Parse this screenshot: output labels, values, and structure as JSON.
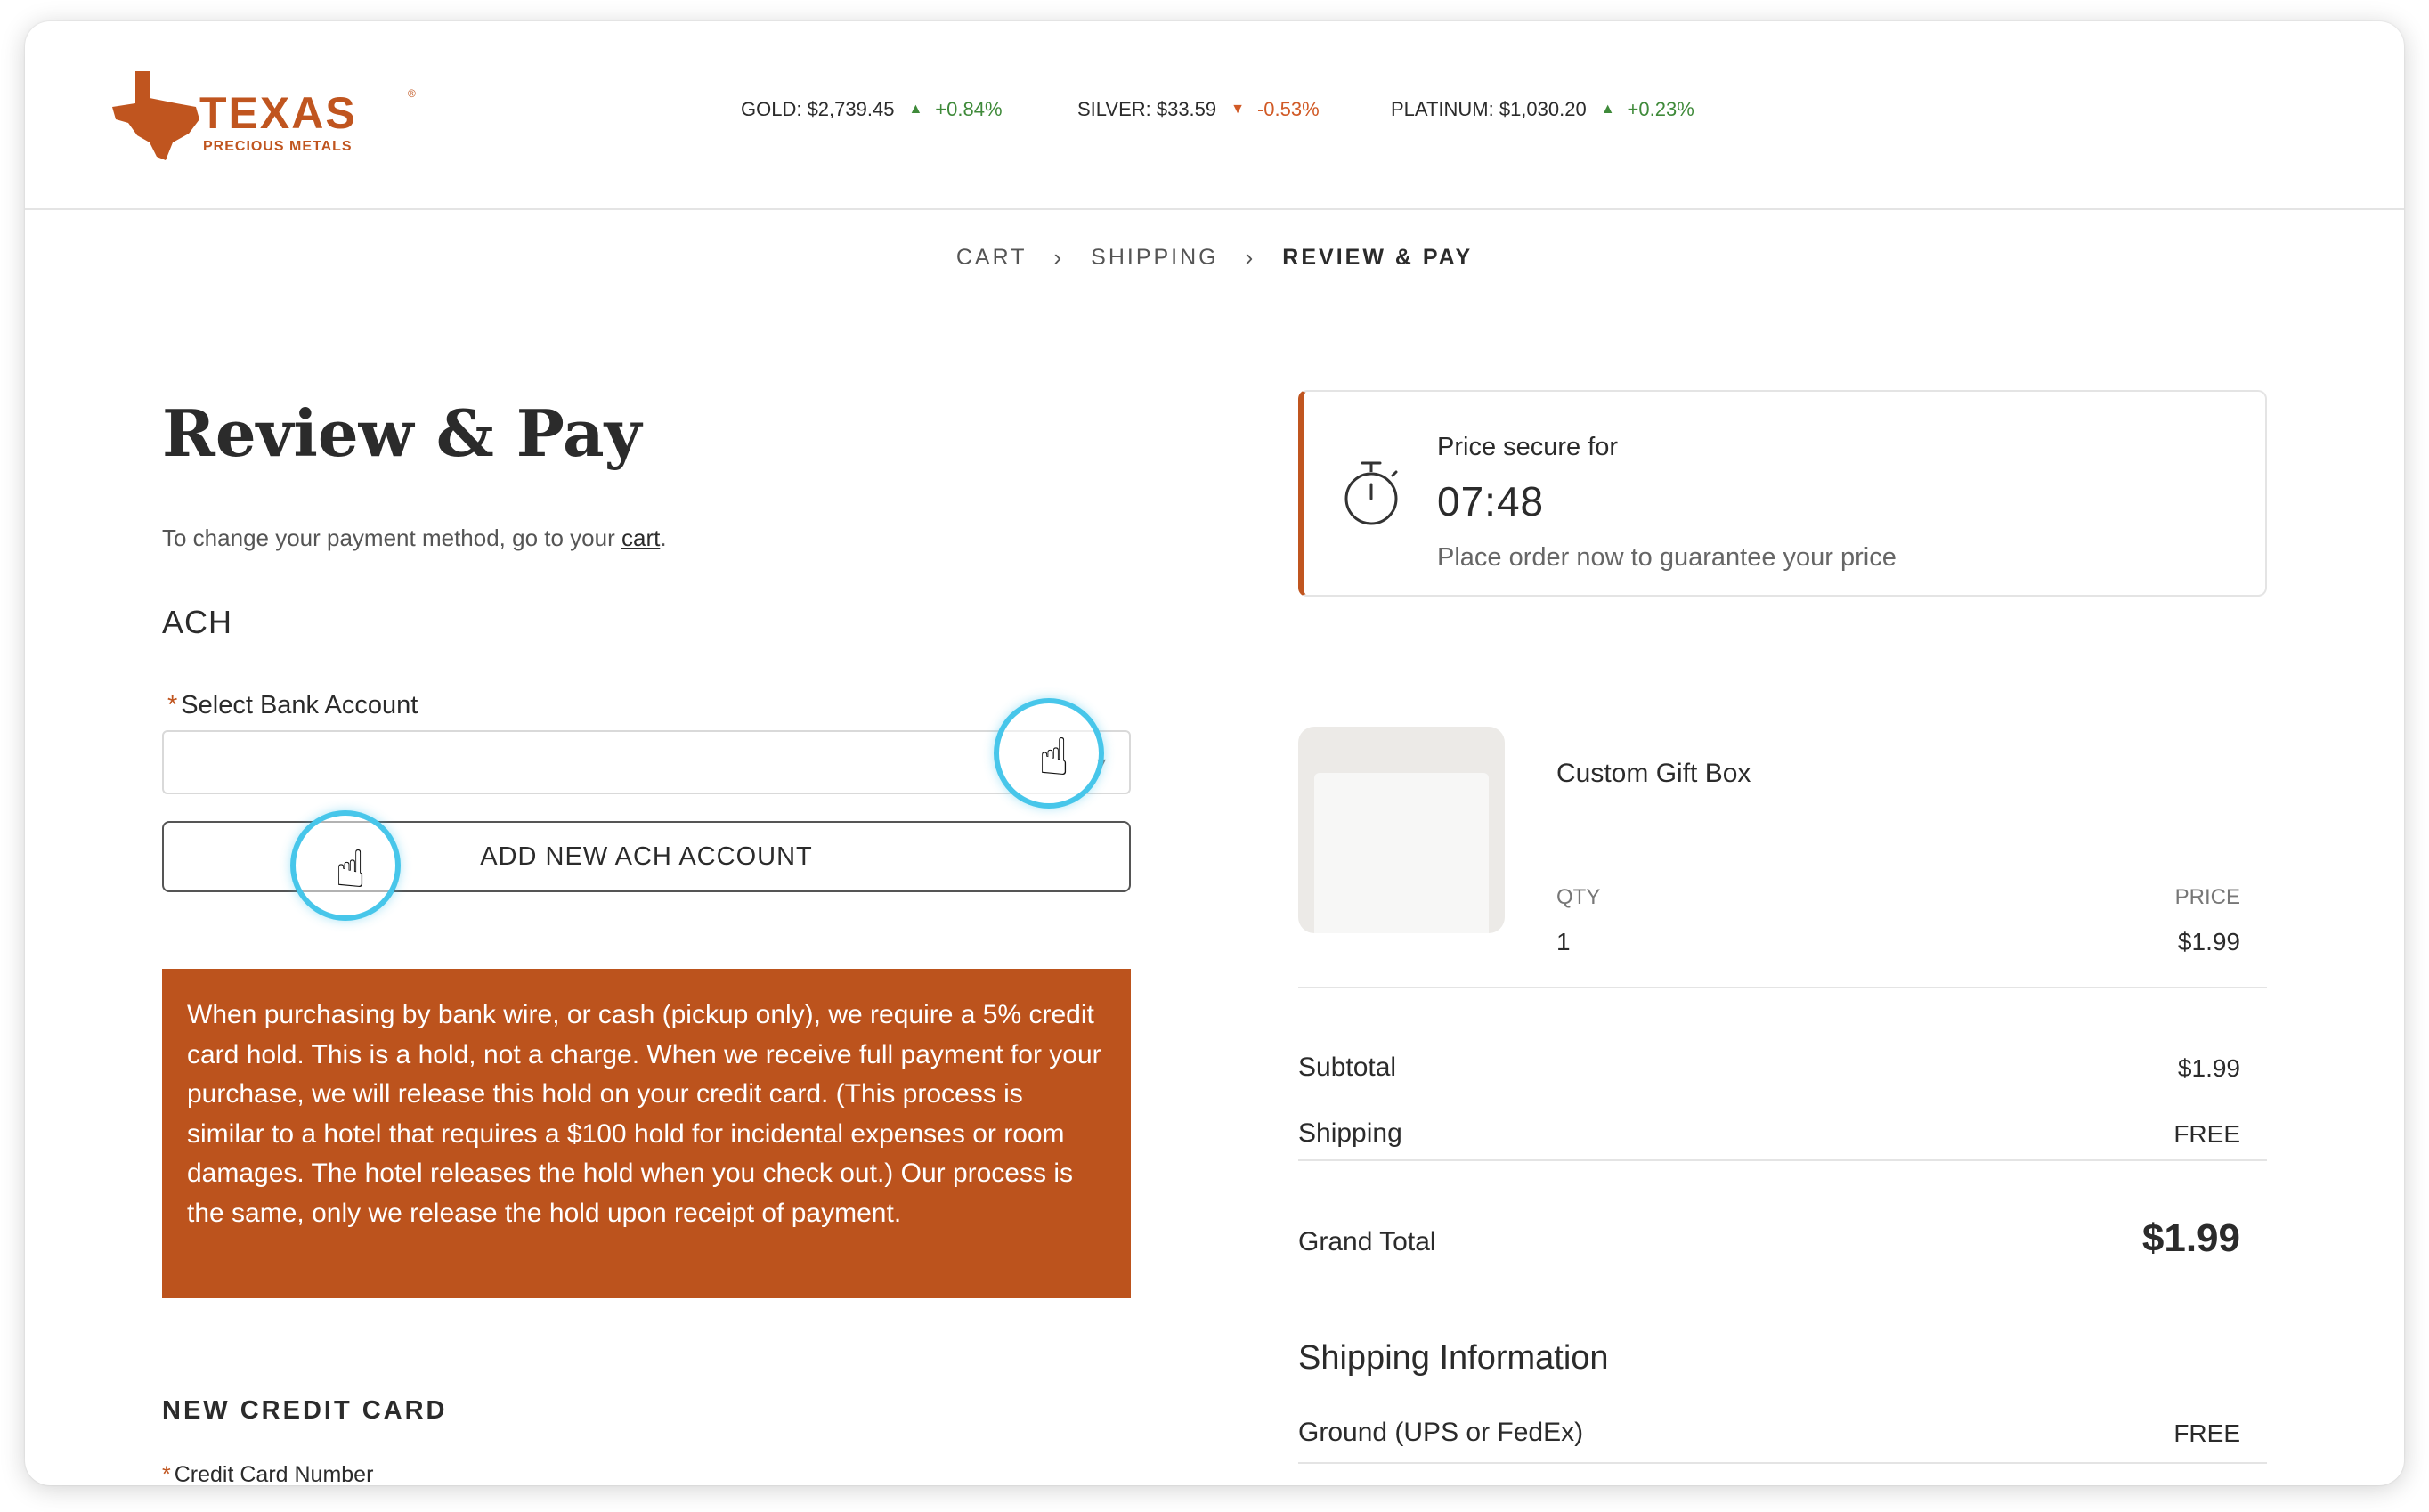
{
  "brand": {
    "name": "TEXAS",
    "registered": "®",
    "tagline": "PRECIOUS METALS",
    "color": "#c0551f"
  },
  "ticker": [
    {
      "label": "GOLD: $2,739.45",
      "direction": "up",
      "change": "+0.84%"
    },
    {
      "label": "SILVER: $33.59",
      "direction": "down",
      "change": "-0.53%"
    },
    {
      "label": "PLATINUM: $1,030.20",
      "direction": "up",
      "change": "+0.23%"
    }
  ],
  "breadcrumb": {
    "step1": "CART",
    "step2": "SHIPPING",
    "step3": "REVIEW & PAY",
    "separator": "›"
  },
  "page": {
    "title": "Review & Pay",
    "note_prefix": "To change your payment method, go to your ",
    "note_link": "cart",
    "note_suffix": "."
  },
  "ach": {
    "heading": "ACH",
    "select_label": "Select Bank Account",
    "required_mark": "*",
    "select_value": "",
    "add_button": "ADD NEW ACH ACCOUNT"
  },
  "notice": {
    "text": "When purchasing by bank wire, or cash (pickup only), we require a 5% credit card hold. This is a hold, not a charge. When we receive full payment for your purchase, we will release this hold on your credit card. (This process is similar to a hotel that requires a $100 hold for incidental expenses or room damages. The hotel releases the hold when you check out.) Our process is the same, only we release the hold upon receipt of payment.",
    "bg_color": "#bc531d"
  },
  "credit_card": {
    "heading": "NEW CREDIT CARD",
    "number_label": "Credit Card Number",
    "required_mark": "*"
  },
  "timer": {
    "label": "Price secure for",
    "time": "07:48",
    "message": "Place order now to guarantee your price"
  },
  "cart_item": {
    "name": "Custom Gift Box",
    "qty_header": "QTY",
    "qty": "1",
    "price_header": "PRICE",
    "price": "$1.99"
  },
  "summary": {
    "subtotal_label": "Subtotal",
    "subtotal": "$1.99",
    "shipping_label": "Shipping",
    "shipping": "FREE",
    "grand_total_label": "Grand Total",
    "grand_total": "$1.99"
  },
  "shipping_info": {
    "heading": "Shipping Information",
    "method": "Ground (UPS or FedEx)",
    "cost": "FREE"
  },
  "cursor_icon": "pointer-hand-icon",
  "accent_ring_color": "#47c6ea"
}
